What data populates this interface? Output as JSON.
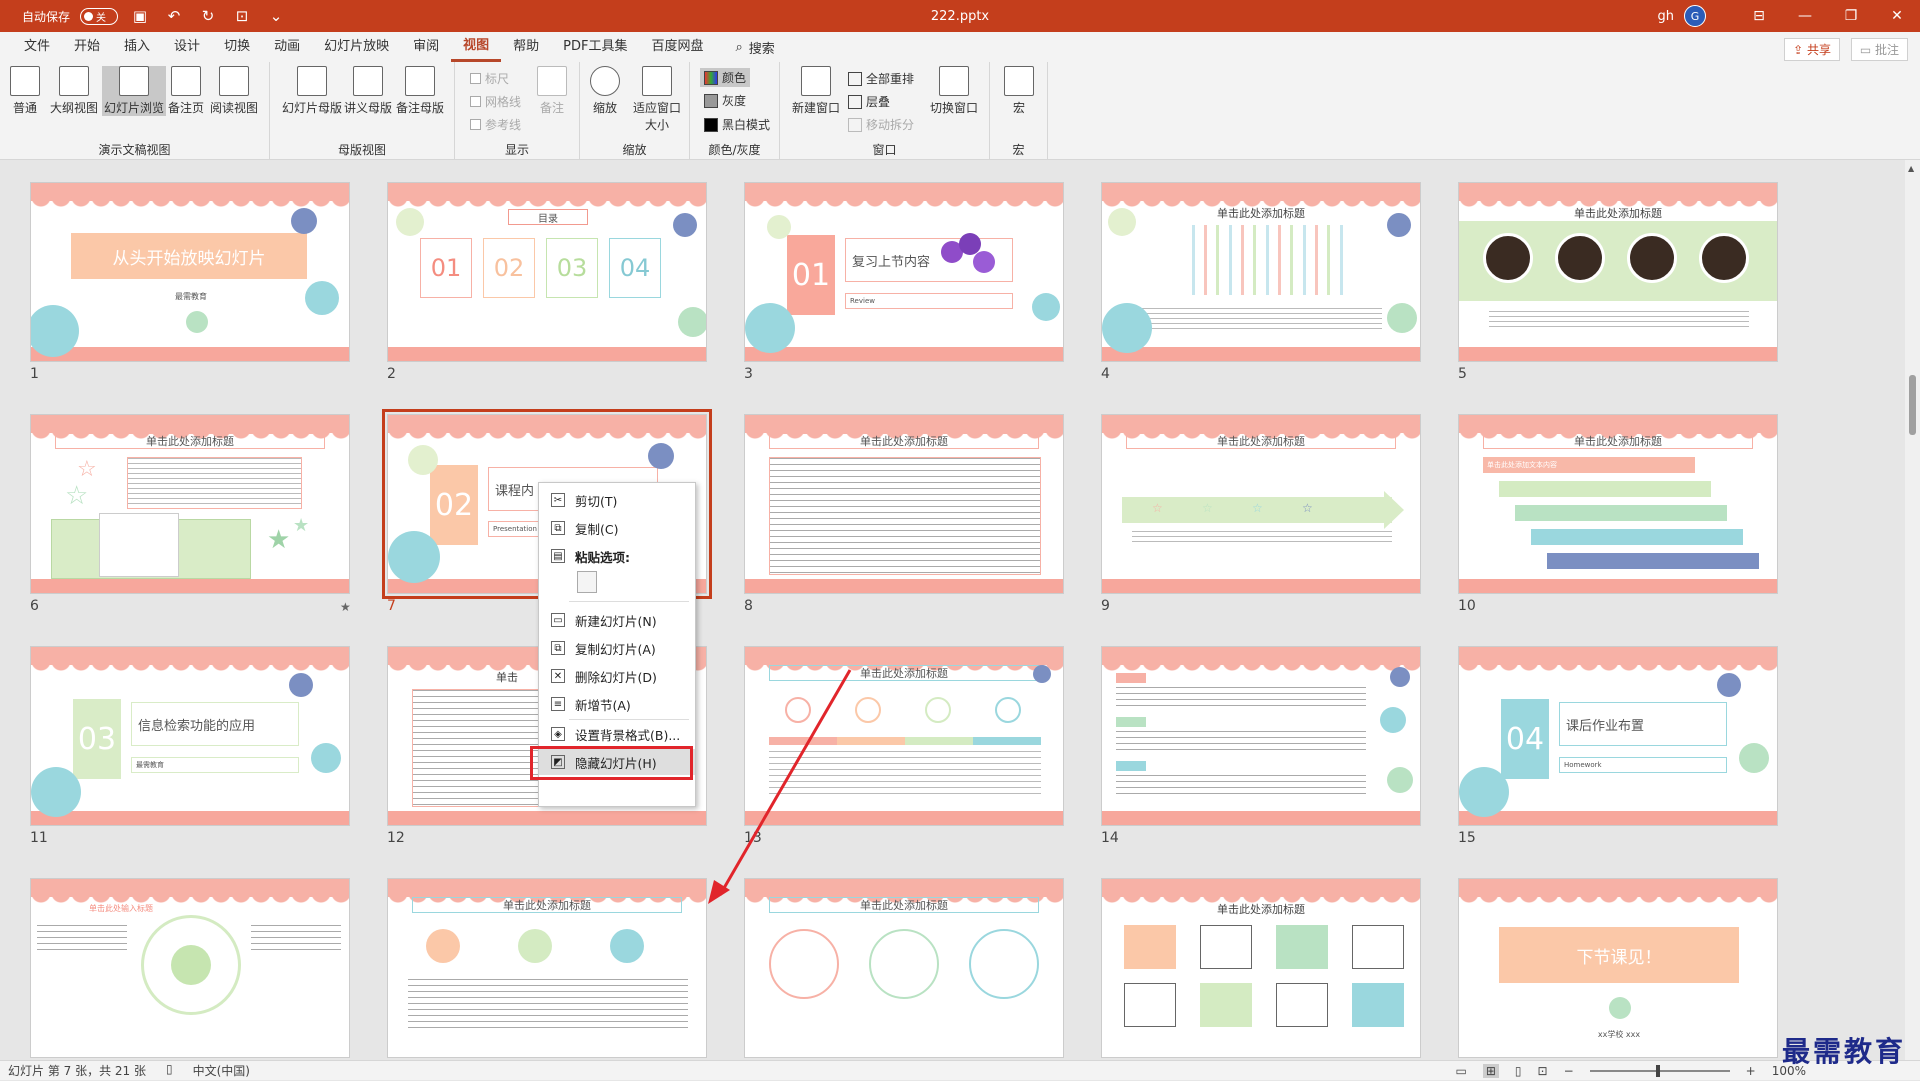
{
  "titlebar": {
    "autosave_label": "自动保存",
    "autosave_state": "关",
    "doc_title": "222.pptx",
    "user": "gh",
    "avatar_letter": "G"
  },
  "menu": {
    "tabs": [
      "文件",
      "开始",
      "插入",
      "设计",
      "切换",
      "动画",
      "幻灯片放映",
      "审阅",
      "视图",
      "帮助",
      "PDF工具集",
      "百度网盘"
    ],
    "active": "视图",
    "search": "搜索",
    "share": "共享",
    "comment": "批注"
  },
  "ribbon": {
    "presentation_views": {
      "label": "演示文稿视图",
      "buttons": [
        "普通",
        "大纲视图",
        "幻灯片浏览",
        "备注页",
        "阅读视图"
      ]
    },
    "master_views": {
      "label": "母版视图",
      "buttons": [
        "幻灯片母版",
        "讲义母版",
        "备注母版"
      ]
    },
    "show": {
      "label": "显示",
      "checks": [
        "标尺",
        "网格线",
        "参考线"
      ],
      "notes": "备注"
    },
    "zoom": {
      "label": "缩放",
      "zoom": "缩放",
      "fit": "适应窗口大小"
    },
    "color": {
      "label": "颜色/灰度",
      "items": [
        "颜色",
        "灰度",
        "黑白模式"
      ]
    },
    "window": {
      "label": "窗口",
      "new_window": "新建窗口",
      "items": [
        "全部重排",
        "层叠",
        "移动拆分"
      ],
      "switch": "切换窗口"
    },
    "macro": {
      "label": "宏",
      "button": "宏"
    }
  },
  "slides": [
    {
      "num": "1",
      "text": "从头开始放映幻灯片",
      "sub": "最需教育"
    },
    {
      "num": "2",
      "text": "目录",
      "items": [
        "01",
        "02",
        "03",
        "04"
      ]
    },
    {
      "num": "3",
      "text": "复习上节内容",
      "big": "01",
      "sub": "Review"
    },
    {
      "num": "4",
      "text": "单击此处添加标题"
    },
    {
      "num": "5",
      "text": "单击此处添加标题"
    },
    {
      "num": "6",
      "text": "单击此处添加标题"
    },
    {
      "num": "7",
      "text": "课程内",
      "big": "02",
      "sub": "Presentation"
    },
    {
      "num": "8",
      "text": "单击此处添加标题"
    },
    {
      "num": "9",
      "text": "单击此处添加标题"
    },
    {
      "num": "10",
      "text": "单击此处添加标题",
      "sub": "单击此处添加文本内容"
    },
    {
      "num": "11",
      "text": "信息检索功能的应用",
      "big": "03",
      "sub": "最需教育"
    },
    {
      "num": "12",
      "text": "单击"
    },
    {
      "num": "13",
      "text": "单击此处添加标题"
    },
    {
      "num": "14",
      "text": ""
    },
    {
      "num": "15",
      "text": "课后作业布置",
      "big": "04",
      "sub": "Homework"
    },
    {
      "num": "",
      "text": "单击此处输入标题"
    },
    {
      "num": "",
      "text": "单击此处添加标题"
    },
    {
      "num": "",
      "text": "单击此处添加标题"
    },
    {
      "num": "",
      "text": "单击此处添加标题"
    },
    {
      "num": "",
      "text": "下节课见！",
      "sub": "xx学校 xxx"
    }
  ],
  "context_menu": {
    "items": [
      "剪切(T)",
      "复制(C)",
      "粘贴选项:",
      "新建幻灯片(N)",
      "复制幻灯片(A)",
      "删除幻灯片(D)",
      "新增节(A)",
      "设置背景格式(B)...",
      "隐藏幻灯片(H)"
    ]
  },
  "statusbar": {
    "slide_info": "幻灯片 第 7 张，共 21 张",
    "language": "中文(中国)",
    "zoom": "100%"
  },
  "watermark": "最需教育",
  "colors": {
    "accent": "#c43e1c",
    "band": "#f7b1a6",
    "highlight": "#e1252b"
  }
}
